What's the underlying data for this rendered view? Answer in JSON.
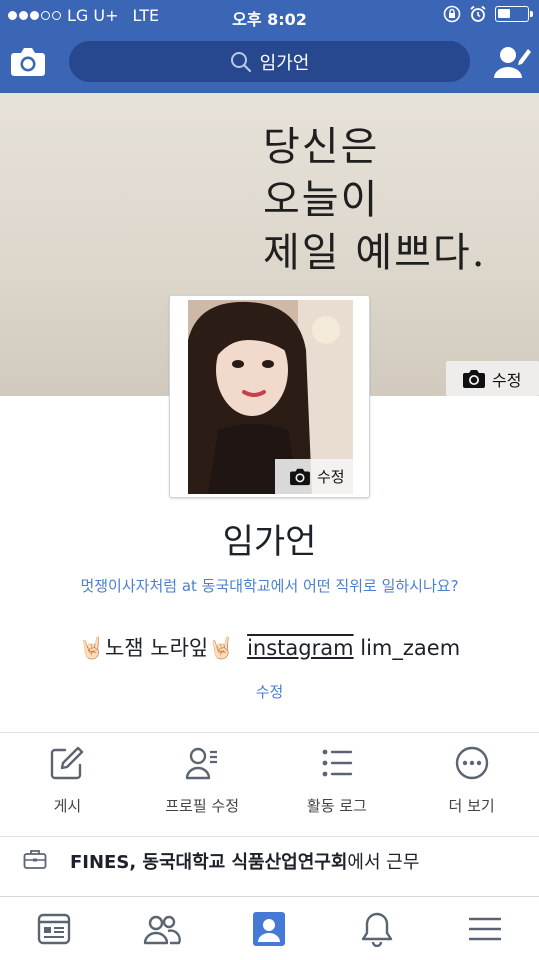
{
  "status_bar": {
    "carrier": "LG U+",
    "network": "LTE",
    "time": "오후 8:02"
  },
  "nav": {
    "search_label": "임가언"
  },
  "cover": {
    "text_lines": [
      "당신은",
      "오늘이",
      "제일 예쁘다."
    ],
    "edit_label": "수정"
  },
  "profile": {
    "photo_edit_label": "수정",
    "name": "임가언",
    "job_prompt": "멋쟁이사자처럼 at 동국대학교에서 어떤 직위로 일하시나요?",
    "bio": {
      "emoji_left": "🤘🏻",
      "text": "노잼 노라잎",
      "emoji_right": "🤘🏻",
      "instagram_label": "instagram",
      "handle": "lim_zaem"
    },
    "bio_edit_label": "수정"
  },
  "actions": [
    {
      "icon": "pencil-square-icon",
      "label": "게시"
    },
    {
      "icon": "profile-edit-icon",
      "label": "프로필 수정"
    },
    {
      "icon": "list-icon",
      "label": "활동 로그"
    },
    {
      "icon": "more-dots-icon",
      "label": "더 보기"
    }
  ],
  "work": {
    "icon": "briefcase-icon",
    "company": "FINES, 동국대학교 식품산업연구회",
    "suffix": "에서 근무"
  },
  "tabbar": [
    {
      "icon": "news-feed-icon",
      "active": false
    },
    {
      "icon": "friends-icon",
      "active": false
    },
    {
      "icon": "profile-icon",
      "active": true
    },
    {
      "icon": "notifications-bell-icon",
      "active": false
    },
    {
      "icon": "menu-icon",
      "active": false
    }
  ],
  "colors": {
    "brand_blue": "#3b66b6",
    "link_blue": "#4b80d0",
    "active_tab": "#4479d6",
    "inactive_tab": "#5b6472"
  }
}
